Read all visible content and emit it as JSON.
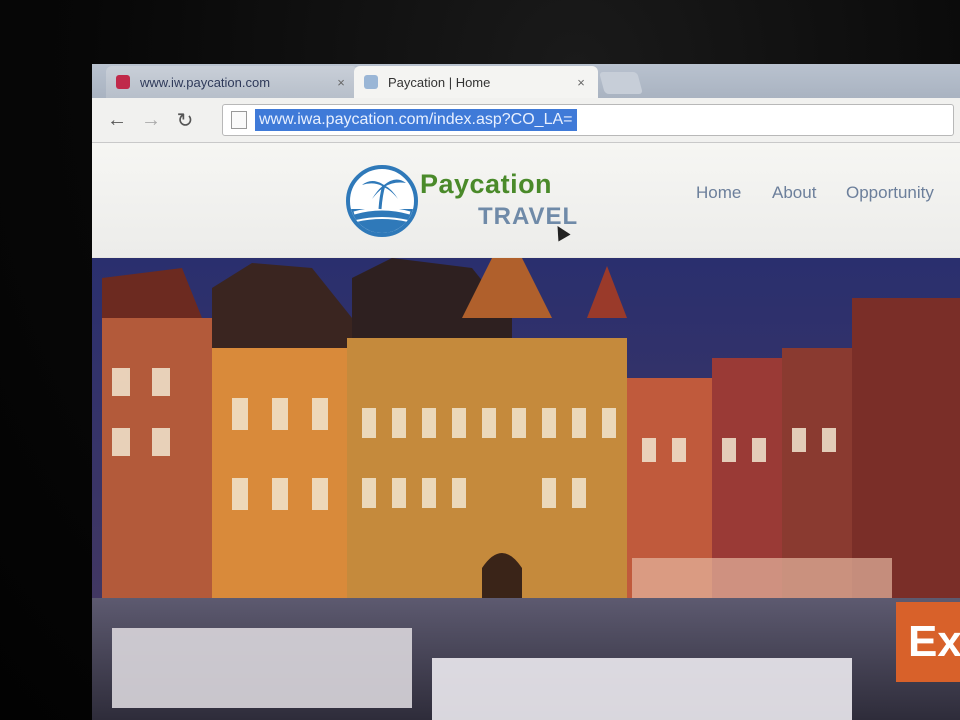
{
  "browser": {
    "tabs": [
      {
        "title": "www.iw.paycation.com",
        "active": false
      },
      {
        "title": "Paycation | Home",
        "active": true
      }
    ],
    "close_glyph": "×",
    "url": "www.iwa.paycation.com/index.asp?CO_LA=",
    "buttons": {
      "back": "←",
      "forward": "→",
      "reload": "↻"
    }
  },
  "site": {
    "brand": "Paycation",
    "brand_sub": "TRAVEL",
    "nav": [
      "Home",
      "About",
      "Opportunity"
    ],
    "cta_label": "Ex"
  },
  "colors": {
    "brand_green": "#4a8a2a",
    "logo_blue": "#2f79b9",
    "cta_orange": "#d8612a",
    "url_highlight": "#3f7ad8"
  },
  "icons": {
    "logo": "palm-tree-island-icon",
    "tab_favicon_inactive": "site-favicon-icon",
    "tab_favicon_active": "page-favicon-icon",
    "page_icon": "page-icon"
  }
}
